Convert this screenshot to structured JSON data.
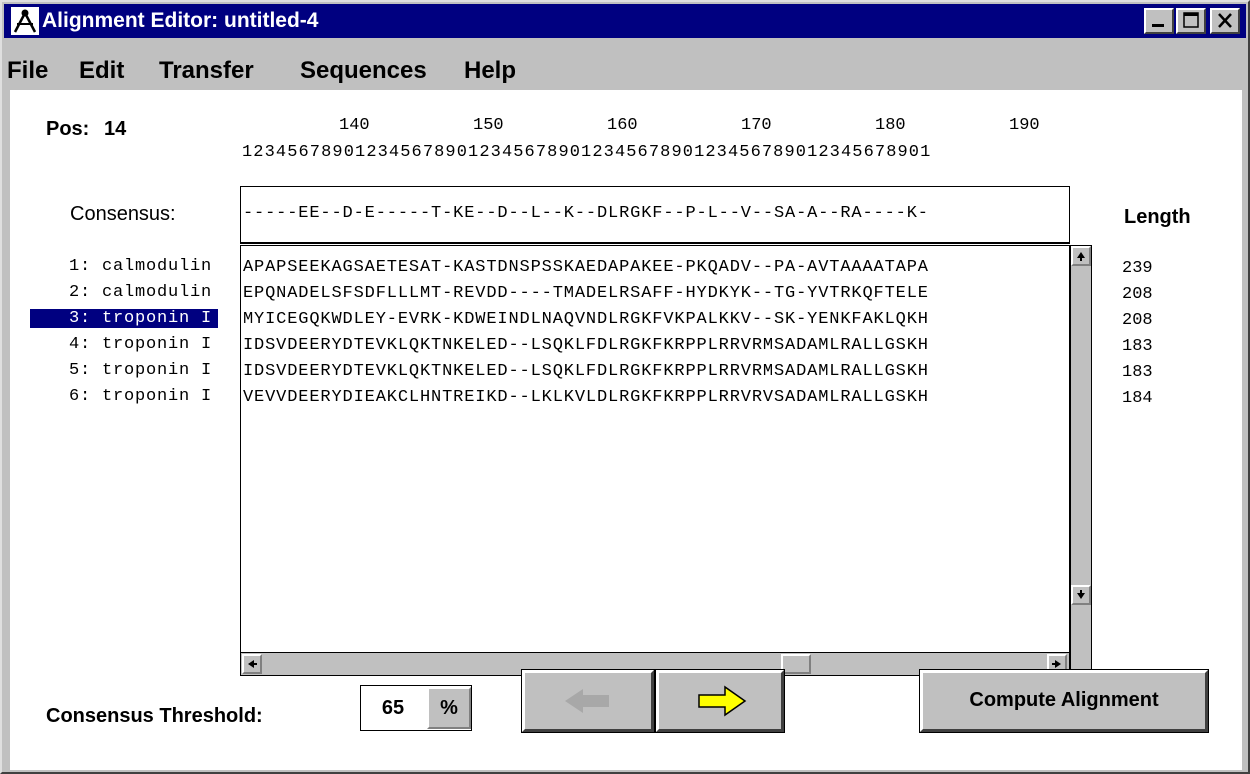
{
  "window": {
    "title": "Alignment Editor: untitled-4"
  },
  "menu": [
    "File",
    "Edit",
    "Transfer",
    "Sequences",
    "Help"
  ],
  "position": {
    "label": "Pos:",
    "value": "14"
  },
  "ruler": {
    "numbers": [
      "140",
      "150",
      "160",
      "170",
      "180",
      "190"
    ],
    "digits": "1234567890123456789012345678901234567890123456789012345678901"
  },
  "consensus": {
    "label": "Consensus:",
    "sequence": "-----EE--D-E-----T-KE--D--L--K--DLRGKF--P-L--V--SA-A--RA----K-"
  },
  "length_header": "Length",
  "sequences": [
    {
      "name": "1: calmodulin",
      "data": "APAPSEEKAGSAETESAT-KASTDNSPSSKAEDAPAKEE-PKQADV--PA-AVTAAAATAPA",
      "length": "239",
      "selected": false
    },
    {
      "name": "2: calmodulin",
      "data": "EPQNADELSFSDFLLLMT-REVDD----TMADELRSAFF-HYDKYK--TG-YVTRKQFTELE",
      "length": "208",
      "selected": false
    },
    {
      "name": "3: troponin I",
      "data": "MYICEGQKWDLEY-EVRK-KDWEINDLNAQVNDLRGKFVKPALKKV--SK-YENKFAKLQKH",
      "length": "208",
      "selected": true
    },
    {
      "name": "4: troponin I",
      "data": "IDSVDEERYDTEVKLQKTNKELED--LSQKLFDLRGKFKRPPLRRVRMSADAMLRALLGSKH",
      "length": "183",
      "selected": false
    },
    {
      "name": "5: troponin I",
      "data": "IDSVDEERYDTEVKLQKTNKELED--LSQKLFDLRGKFKRPPLRRVRMSADAMLRALLGSKH",
      "length": "183",
      "selected": false
    },
    {
      "name": "6: troponin I",
      "data": "VEVVDEERYDIEAKCLHNTREIKD--LKLKVLDLRGKFKRPPLRRVRVSADAMLRALLGSKH",
      "length": "184",
      "selected": false
    }
  ],
  "threshold": {
    "label": "Consensus Threshold:",
    "value": "65",
    "unit": "%"
  },
  "buttons": {
    "compute": "Compute Alignment"
  },
  "colors": {
    "titlebar": "#000080",
    "selection": "#000080",
    "arrow_active": "#ffff00",
    "arrow_disabled": "#a8a8a8"
  }
}
